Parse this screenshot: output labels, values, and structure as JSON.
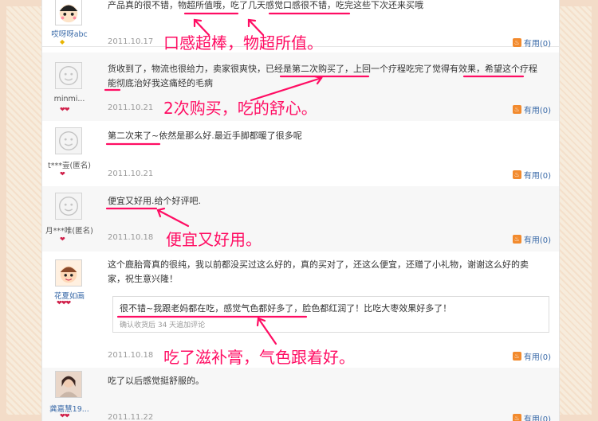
{
  "reviews": [
    {
      "user": "哎呀呀abc",
      "badge": "◆",
      "text": "产品真的很不错，物超所值哦，吃了几天感觉口感很不错，吃完这些下次还来买哦",
      "date": "2011.10.17",
      "helpful": "有用(0)"
    },
    {
      "user": "minmi...",
      "badge": "❤❤",
      "text": "货收到了，物流也很给力，卖家很爽快，已经是第二次购买了，上回一个疗程吃完了觉得有效果，希望这个疗程能彻底治好我这痛经的毛病",
      "date": "2011.10.21",
      "helpful": "有用(0)"
    },
    {
      "user": "t***壹(匿名)",
      "badge": "❤",
      "text": "第二次来了~依然是那么好.最近手脚都暖了很多呢",
      "date": "2011.10.21",
      "helpful": "有用(0)"
    },
    {
      "user": "月***唯(匿名)",
      "badge": "❤",
      "text": "便宜又好用.给个好评吧.",
      "date": "2011.10.18",
      "helpful": "有用(0)"
    },
    {
      "user": "花夏如画",
      "badge": "❤❤❤",
      "text": "这个鹿胎膏真的很纯，我以前都没买过这么好的，真的买对了，还这么便宜，还赠了小礼物，谢谢这么好的卖家，祝生意兴隆！",
      "date": "2011.10.18",
      "helpful": "有用(0)",
      "followup": {
        "text": "很不错~我跟老妈都在吃，感觉气色都好多了，脸色都红润了！比吃大枣效果好多了！",
        "meta": "确认收货后 34 天追加评论"
      }
    },
    {
      "user": "龚嘉慧19...",
      "badge": "❤❤",
      "text": "吃了以后感觉挺舒服的。",
      "date": "2011.11.22",
      "helpful": "有用(0)"
    }
  ],
  "annotations": [
    "口感超棒，物超所值。",
    "2次购买，吃的舒心。",
    "便宜又好用。",
    "吃了滋补膏，气色跟着好。"
  ],
  "colors": {
    "annotation": "#ff0d63",
    "username": "#3a6aa8"
  }
}
